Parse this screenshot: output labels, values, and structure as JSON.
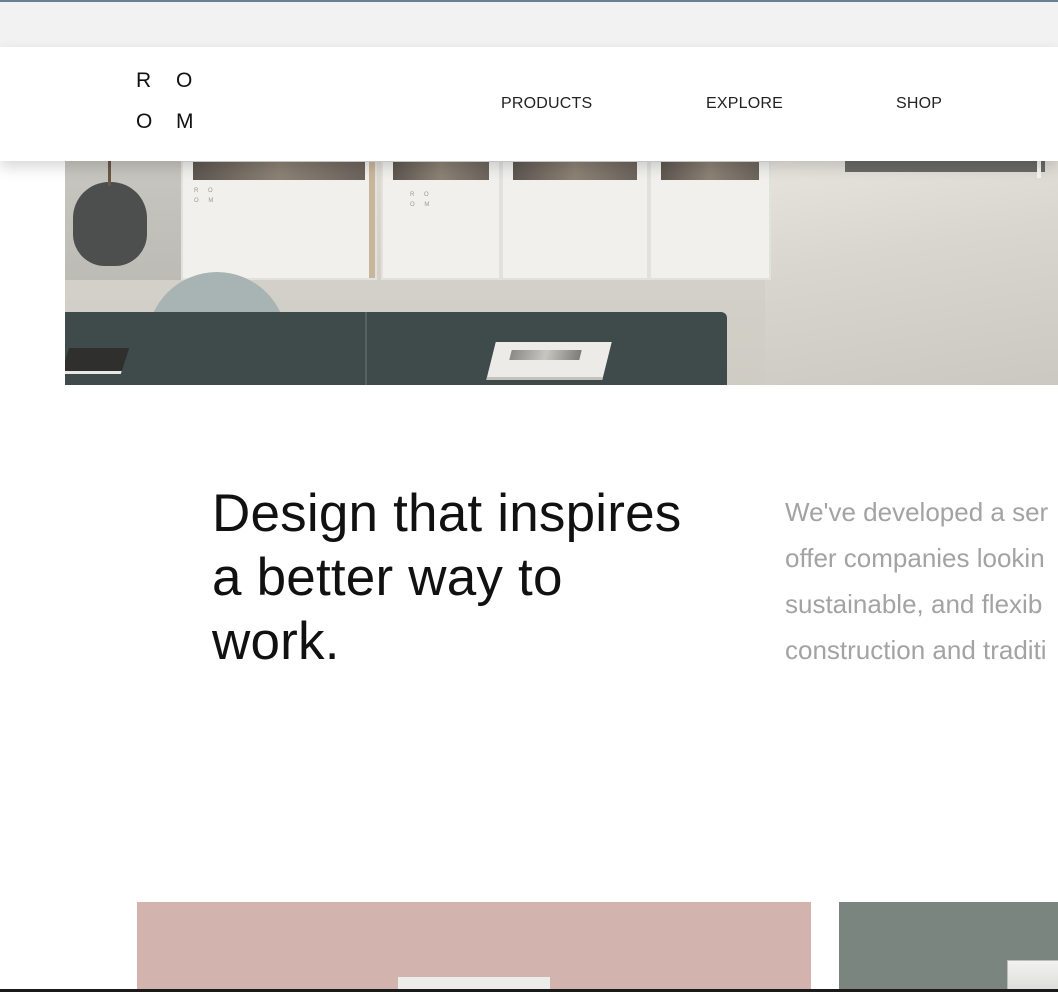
{
  "header": {
    "logo_letters": [
      "R",
      "O",
      "O",
      "M"
    ],
    "nav": {
      "products": "PRODUCTS",
      "explore": "EXPLORE",
      "shop": "SHOP"
    }
  },
  "hero": {
    "cabinet_mark": "R O O M"
  },
  "intro": {
    "headline": "Design that inspires a better way to work.",
    "body_lines": [
      "We've developed a ser",
      "offer companies lookin",
      "sustainable, and flexib",
      "construction and traditi"
    ]
  },
  "colors": {
    "text_dark": "#111111",
    "text_muted": "#a3a3a3",
    "card_pink": "#d2b3ae",
    "card_grey": "#7b8580",
    "browser_bar": "#f2f2f2"
  },
  "icons": [
    "room-logo",
    "hero-photo",
    "card-image-pink",
    "card-image-grey"
  ]
}
